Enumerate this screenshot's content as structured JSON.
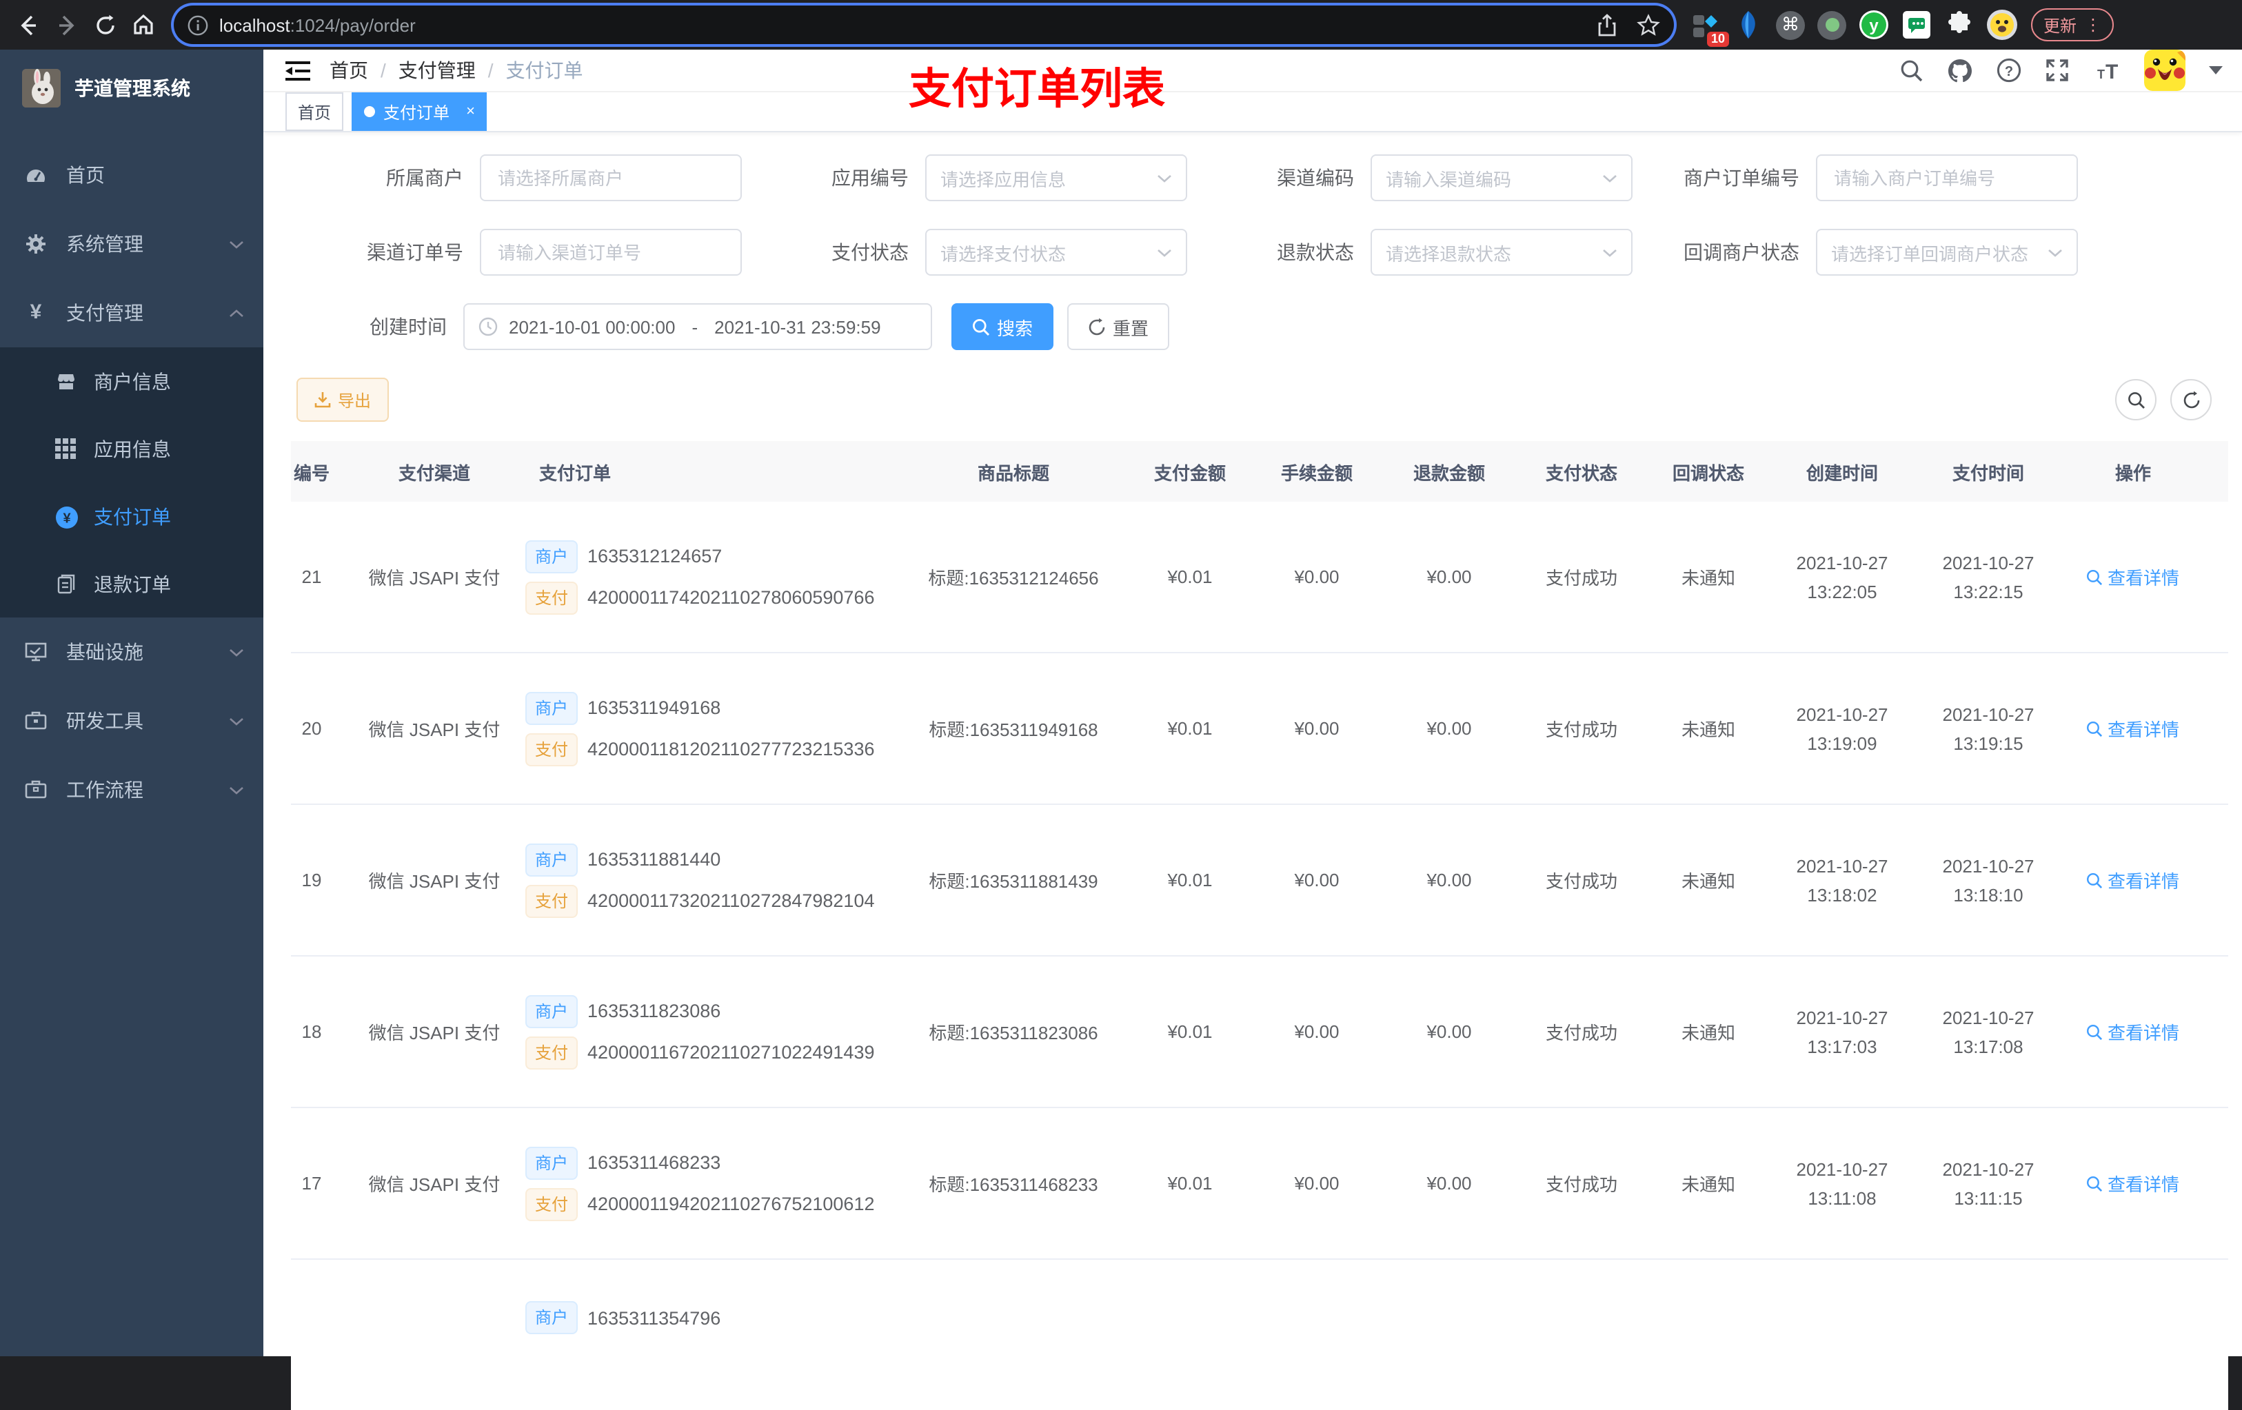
{
  "browser": {
    "url_host": "localhost",
    "url_path": ":1024/pay/order",
    "extension_badge": "10",
    "update_button": "更新",
    "vdots": "⋮"
  },
  "sidebar": {
    "title": "芋道管理系统",
    "items": [
      {
        "label": "首页"
      },
      {
        "label": "系统管理"
      },
      {
        "label": "支付管理"
      },
      {
        "label": "商户信息"
      },
      {
        "label": "应用信息"
      },
      {
        "label": "支付订单"
      },
      {
        "label": "退款订单"
      },
      {
        "label": "基础设施"
      },
      {
        "label": "研发工具"
      },
      {
        "label": "工作流程"
      }
    ]
  },
  "header": {
    "breadcrumb": {
      "home": "首页",
      "sep1": "/",
      "section": "支付管理",
      "sep2": "/",
      "current": "支付订单"
    },
    "annotation": "支付订单列表"
  },
  "tags": {
    "first": "首页",
    "active": "支付订单",
    "close": "×"
  },
  "filter": {
    "owner": {
      "label": "所属商户",
      "placeholder": "请选择所属商户"
    },
    "app": {
      "label": "应用编号",
      "placeholder": "请选择应用信息"
    },
    "channel_code": {
      "label": "渠道编码",
      "placeholder": "请输入渠道编码"
    },
    "merchant_order_no": {
      "label": "商户订单编号",
      "placeholder": "请输入商户订单编号"
    },
    "channel_order_no": {
      "label": "渠道订单号",
      "placeholder": "请输入渠道订单号"
    },
    "pay_status": {
      "label": "支付状态",
      "placeholder": "请选择支付状态"
    },
    "refund_status": {
      "label": "退款状态",
      "placeholder": "请选择退款状态"
    },
    "callback_status": {
      "label": "回调商户状态",
      "placeholder": "请选择订单回调商户状态"
    },
    "created_time": {
      "label": "创建时间",
      "start": "2021-10-01 00:00:00",
      "separator": "-",
      "end": "2021-10-31 23:59:59"
    },
    "search": "搜索",
    "reset": "重置"
  },
  "toolbar": {
    "export": "导出"
  },
  "table": {
    "columns": [
      "编号",
      "支付渠道",
      "支付订单",
      "商品标题",
      "支付金额",
      "手续金额",
      "退款金额",
      "支付状态",
      "回调状态",
      "创建时间",
      "支付时间",
      "操作"
    ],
    "tag_merchant": "商户",
    "tag_pay": "支付",
    "rows": [
      {
        "id": "21",
        "channel": "微信 JSAPI 支付",
        "merchant_no": "1635312124657",
        "pay_no": "4200001174202110278060590766",
        "title": "标题:1635312124656",
        "amount": "¥0.01",
        "fee": "¥0.00",
        "refund": "¥0.00",
        "status": "支付成功",
        "notify": "未通知",
        "created_date": "2021-10-27",
        "created_time": "13:22:05",
        "paid_date": "2021-10-27",
        "paid_time": "13:22:15",
        "action": "查看详情"
      },
      {
        "id": "20",
        "channel": "微信 JSAPI 支付",
        "merchant_no": "1635311949168",
        "pay_no": "4200001181202110277723215336",
        "title": "标题:1635311949168",
        "amount": "¥0.01",
        "fee": "¥0.00",
        "refund": "¥0.00",
        "status": "支付成功",
        "notify": "未通知",
        "created_date": "2021-10-27",
        "created_time": "13:19:09",
        "paid_date": "2021-10-27",
        "paid_time": "13:19:15",
        "action": "查看详情"
      },
      {
        "id": "19",
        "channel": "微信 JSAPI 支付",
        "merchant_no": "1635311881440",
        "pay_no": "4200001173202110272847982104",
        "title": "标题:1635311881439",
        "amount": "¥0.01",
        "fee": "¥0.00",
        "refund": "¥0.00",
        "status": "支付成功",
        "notify": "未通知",
        "created_date": "2021-10-27",
        "created_time": "13:18:02",
        "paid_date": "2021-10-27",
        "paid_time": "13:18:10",
        "action": "查看详情"
      },
      {
        "id": "18",
        "channel": "微信 JSAPI 支付",
        "merchant_no": "1635311823086",
        "pay_no": "4200001167202110271022491439",
        "title": "标题:1635311823086",
        "amount": "¥0.01",
        "fee": "¥0.00",
        "refund": "¥0.00",
        "status": "支付成功",
        "notify": "未通知",
        "created_date": "2021-10-27",
        "created_time": "13:17:03",
        "paid_date": "2021-10-27",
        "paid_time": "13:17:08",
        "action": "查看详情"
      },
      {
        "id": "17",
        "channel": "微信 JSAPI 支付",
        "merchant_no": "1635311468233",
        "pay_no": "4200001194202110276752100612",
        "title": "标题:1635311468233",
        "amount": "¥0.01",
        "fee": "¥0.00",
        "refund": "¥0.00",
        "status": "支付成功",
        "notify": "未通知",
        "created_date": "2021-10-27",
        "created_time": "13:11:08",
        "paid_date": "2021-10-27",
        "paid_time": "13:11:15",
        "action": "查看详情"
      },
      {
        "merchant_no": "1635311354796"
      }
    ]
  }
}
